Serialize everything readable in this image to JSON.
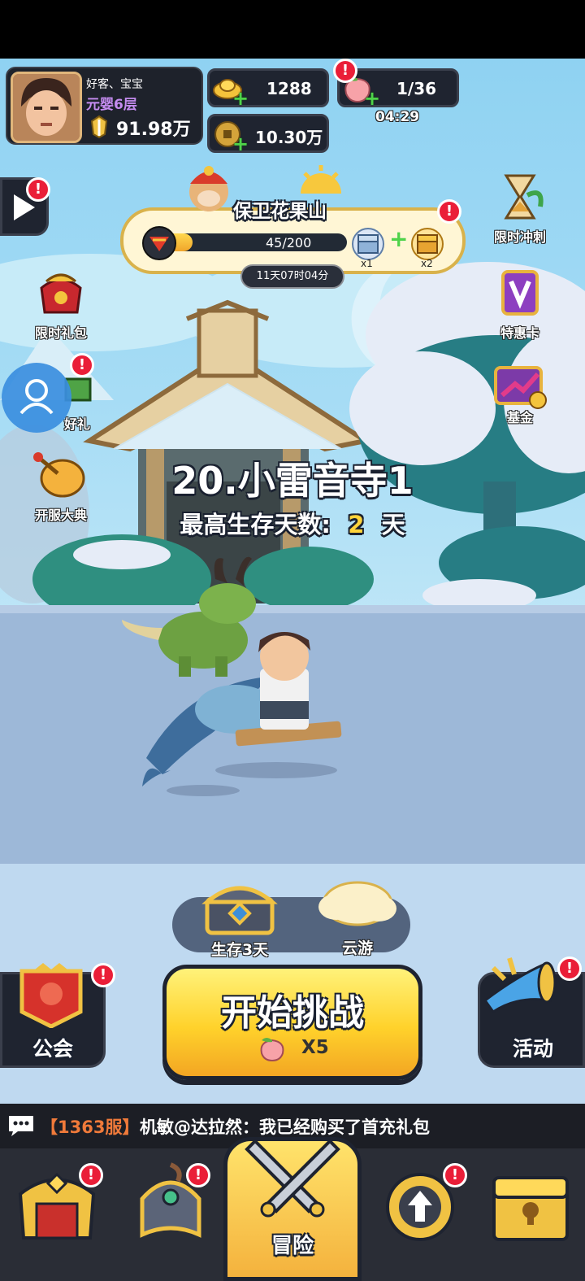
{
  "player": {
    "name": "好客、宝宝",
    "realm": "元婴6层",
    "power": "91.98万"
  },
  "currencies": {
    "gold": "1288",
    "coins": "10.30万",
    "stamina": "1/36",
    "stamina_timer": "04:29"
  },
  "event": {
    "title": "保卫花果山",
    "progress_text": "45/200",
    "progress": 0.225,
    "countdown": "11天07时04分",
    "reward1_count": "x1",
    "reward2_count": "x2"
  },
  "left_menu": {
    "gift_pack": "限时礼包",
    "good_gift": "好礼",
    "opening_ceremony": "开服大典"
  },
  "right_menu": {
    "sprint": "限时冲刺",
    "special_card": "特惠卡",
    "fund": "基金"
  },
  "stage": {
    "name": "20.小雷音寺1",
    "survival_label": "最高生存天数:",
    "survival_days": "2",
    "survival_unit": "天"
  },
  "rewards": {
    "chest_label": "生存3天",
    "cloud_label": "云游"
  },
  "actions": {
    "guild": "公会",
    "start": "开始挑战",
    "start_cost": "X5",
    "activity": "活动"
  },
  "chat": {
    "server": "【1363服】",
    "message": "机敏@达拉然：我已经购买了首充礼包"
  },
  "tabs": {
    "adventure": "冒险"
  },
  "badge_mark": "!"
}
